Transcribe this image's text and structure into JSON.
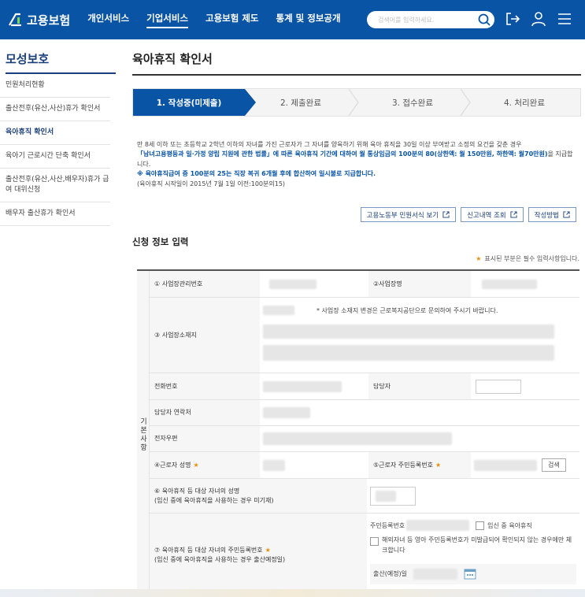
{
  "header": {
    "logo_text": "고용보험",
    "nav": [
      {
        "label": "개인서비스",
        "active": false
      },
      {
        "label": "기업서비스",
        "active": true
      },
      {
        "label": "고용보험 제도",
        "active": false
      },
      {
        "label": "통계 및 정보공개",
        "active": false
      }
    ],
    "search_placeholder": "검색어를 입력하세요.",
    "icons": [
      "search-icon",
      "logout-icon",
      "user-icon",
      "menu-icon"
    ],
    "accent_color": "#0a54a5"
  },
  "sidebar": {
    "title": "모성보호",
    "items": [
      {
        "label": "민원처리현황",
        "active": false
      },
      {
        "label": "출산전후(유산,사산)휴가 확인서",
        "active": false
      },
      {
        "label": "육아휴직 확인서",
        "active": true
      },
      {
        "label": "육아기 근로시간 단축 확인서",
        "active": false
      },
      {
        "label": "출산전후(유산,사산,배우자)휴가 급여 대위신청",
        "active": false
      },
      {
        "label": "배우자 출산휴가 확인서",
        "active": false
      }
    ]
  },
  "main": {
    "title": "육아휴직 확인서",
    "steps": [
      {
        "label": "1. 작성중(미제출)",
        "active": true
      },
      {
        "label": "2. 제출완료",
        "active": false
      },
      {
        "label": "3. 접수완료",
        "active": false
      },
      {
        "label": "4. 처리완료",
        "active": false
      }
    ],
    "desc": {
      "line1": "만 8세 이하 또는 초등학교 2학년 이하의 자녀를 가진 근로자가 그 자녀를 양육하기 위해 육아 휴직을 30일 이상 부여받고 소정의 요건을 갖춘 경우",
      "line2_hl": "「남녀고용평등과 일·가정 양립 지원에 관한 법률」에 따른 육아휴직 기간에 대하여 월 통상임금의 100분의 80(상한액: 월 150만원, 하한액: 월70만원)",
      "line2_rest": "을 지급합니다.",
      "line3": "※ 육아휴직급여 중 100분의 25는 직장 복귀 6개월 후에 합산하여 일시불로 지급합니다.",
      "line4": "(육아휴직 시작일이 2015년 7월 1일 이전:100분의15)"
    },
    "buttons": [
      "고용노동부 민원서식 보기",
      "신고내역 조회",
      "작성방법"
    ],
    "section_title": "신청 정보 입력",
    "required_note": "표시된 부분은 필수 입력사항입니다.",
    "required_mark": "★"
  },
  "form": {
    "group_label": "기본사항",
    "biz_no_label": "① 사업장관리번호",
    "biz_name_label": "②사업장명",
    "address_label": "③ 사업장소재지",
    "address_note": "* 사업장 소재지 변경은 근로복지공단으로 문의하여 주시기 바랍니다.",
    "phone_label": "전화번호",
    "manager_label": "담당자",
    "manager_contact_label": "담당자 연락처",
    "email_label": "전자우편",
    "worker_name_label": "④근로자 성명",
    "worker_rrn_label": "⑤근로자 주민등록번호",
    "search_button": "검색",
    "child_name_label": "⑥ 육아휴직 등 대상 자녀의 성명",
    "child_name_sub": "(임신 중에 육아휴직을 사용하는 경우 미기재)",
    "child_rrn_label": "⑦ 육아휴직 등 대상 자녀의 주민등록번호",
    "child_rrn_sub": "(임신 중에 육아휴직을 사용하는 경우 출산예정일)",
    "rrn_field_label": "주민등록번호",
    "pregnant_check": "임신 중 육아휴직",
    "overseas_check": "해외자녀 등 영아 주민등록번호가 미발급되어 확인되지 않는 경우에만 체크합니다",
    "due_date_label": "출산(예정)일"
  }
}
